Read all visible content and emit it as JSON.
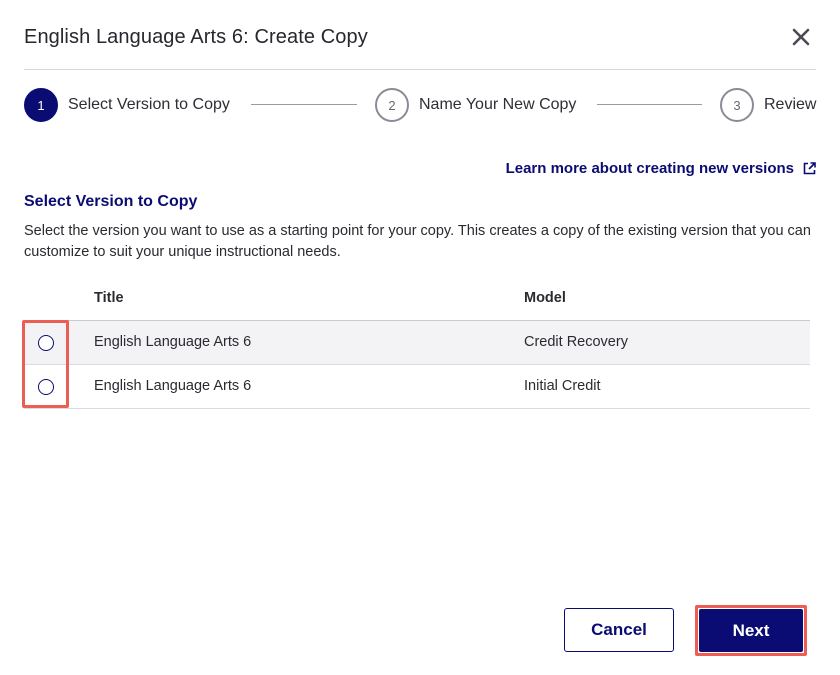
{
  "dialog": {
    "title": "English Language Arts 6: Create Copy"
  },
  "stepper": {
    "steps": [
      {
        "number": "1",
        "label": "Select Version to Copy"
      },
      {
        "number": "2",
        "label": "Name Your New Copy"
      },
      {
        "number": "3",
        "label": "Review"
      }
    ]
  },
  "learn_link": {
    "label": "Learn more about creating new versions",
    "icon": "external-link-icon"
  },
  "section": {
    "title": "Select Version to Copy",
    "description": "Select the version you want to use as a starting point for your copy. This creates a copy of the existing version that you can customize to suit your unique instructional needs."
  },
  "table": {
    "headers": {
      "title": "Title",
      "model": "Model"
    },
    "rows": [
      {
        "title": "English Language Arts 6",
        "model": "Credit Recovery"
      },
      {
        "title": "English Language Arts 6",
        "model": "Initial Credit"
      }
    ]
  },
  "buttons": {
    "cancel": "Cancel",
    "next": "Next"
  },
  "colors": {
    "primary": "#0b0c73",
    "highlight": "#ec5e54"
  }
}
